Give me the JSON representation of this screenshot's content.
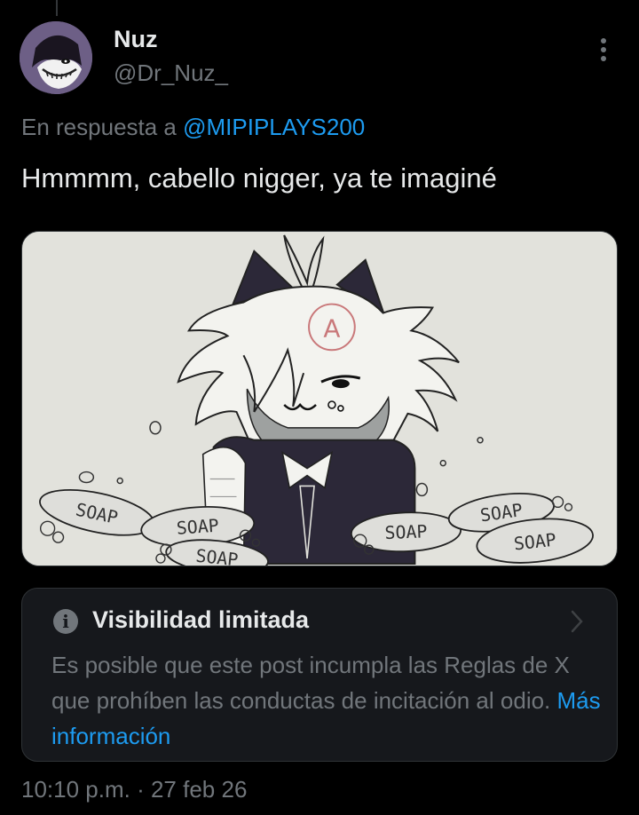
{
  "author": {
    "name": "Nuz",
    "handle": "@Dr_Nuz_",
    "avatar_icon": "character-avatar"
  },
  "reply": {
    "prefix": "En respuesta a ",
    "mention": "@MIPIPLAYS200"
  },
  "tweet": {
    "text": "Hmmmm, cabello nigger, ya te imaginé"
  },
  "media": {
    "soap_labels": [
      "SOAP",
      "SOAP",
      "SOAP",
      "SOAP",
      "SOAP",
      "SOAP"
    ],
    "forehead_mark": "A"
  },
  "notice": {
    "icon": "info-icon",
    "title": "Visibilidad limitada",
    "body": "Es posible que este post incumpla las Reglas de X que prohíben las conductas de incitación al odio.",
    "link": "Más información"
  },
  "meta": {
    "time": "10:10 p.m.",
    "separator": " · ",
    "date": "27 feb 26"
  },
  "colors": {
    "background": "#000000",
    "text": "#e7e9ea",
    "muted": "#71767b",
    "link": "#1d9bf0",
    "card": "#16181c"
  }
}
